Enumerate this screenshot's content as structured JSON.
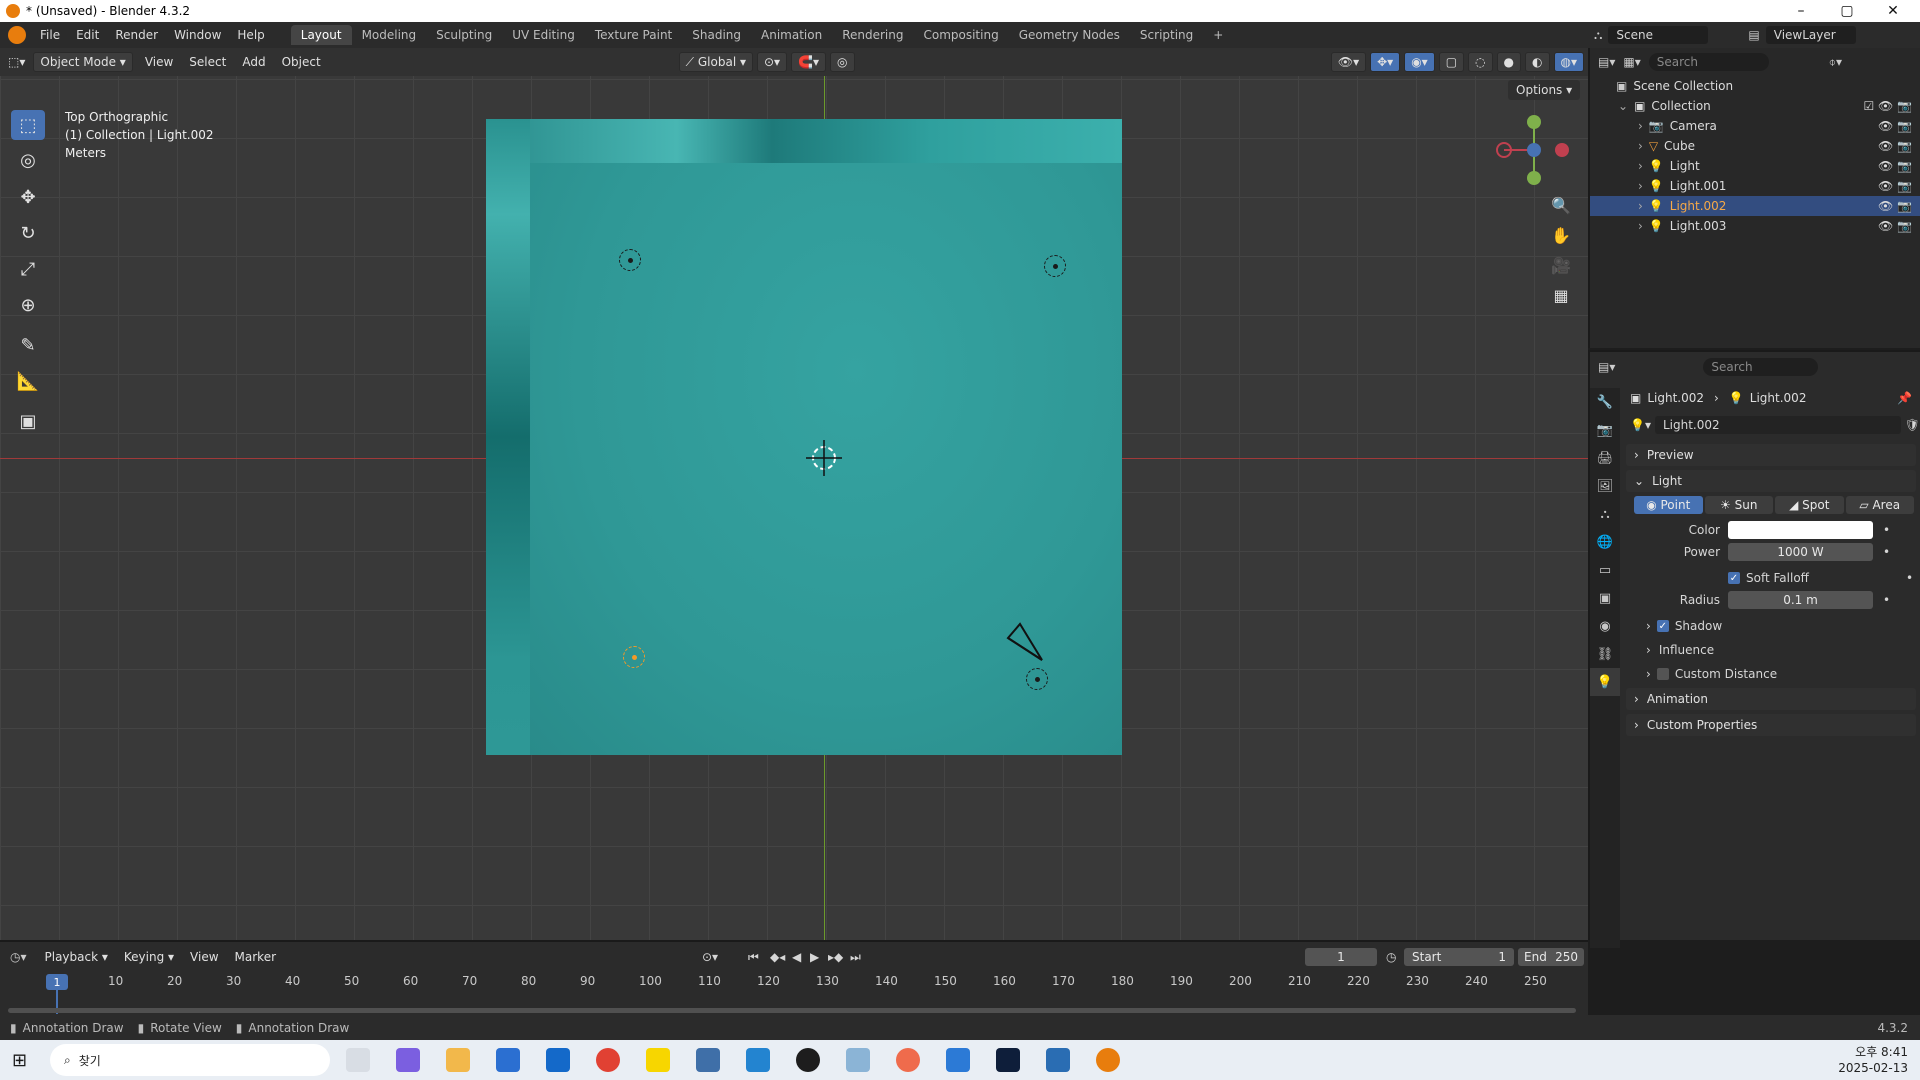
{
  "window": {
    "title": "* (Unsaved) - Blender 4.3.2",
    "minimize": "–",
    "maximize": "▢",
    "close": "✕"
  },
  "menu": {
    "items": [
      "File",
      "Edit",
      "Render",
      "Window",
      "Help"
    ]
  },
  "workspaces": {
    "tabs": [
      "Layout",
      "Modeling",
      "Sculpting",
      "UV Editing",
      "Texture Paint",
      "Shading",
      "Animation",
      "Rendering",
      "Compositing",
      "Geometry Nodes",
      "Scripting"
    ],
    "active": "Layout",
    "add": "+"
  },
  "scene": {
    "scene_name": "Scene",
    "view_layer": "ViewLayer"
  },
  "viewport": {
    "mode": "Object Mode",
    "menus": [
      "View",
      "Select",
      "Add",
      "Object"
    ],
    "transform_orientation": "Global",
    "options": "Options",
    "overlay_lines": [
      "Top Orthographic",
      "(1) Collection | Light.002",
      "Meters"
    ],
    "gizmo": {
      "x": "X",
      "y": "Y",
      "z": "Z"
    }
  },
  "outliner": {
    "search_placeholder": "Search",
    "root": "Scene Collection",
    "collection": "Collection",
    "items": [
      {
        "name": "Camera"
      },
      {
        "name": "Cube"
      },
      {
        "name": "Light"
      },
      {
        "name": "Light.001"
      },
      {
        "name": "Light.002",
        "selected": true
      },
      {
        "name": "Light.003"
      }
    ]
  },
  "properties": {
    "search_placeholder": "Search",
    "breadcrumb": [
      "Light.002",
      "Light.002"
    ],
    "datablock": "Light.002",
    "panels": {
      "preview": "Preview",
      "light": "Light",
      "animation": "Animation",
      "custom_properties": "Custom Properties"
    },
    "light_types": [
      "Point",
      "Sun",
      "Spot",
      "Area"
    ],
    "active_type": "Point",
    "color_label": "Color",
    "color_value": "#ffffff",
    "power_label": "Power",
    "power_value": "1000 W",
    "soft_falloff": "Soft Falloff",
    "radius_label": "Radius",
    "radius_value": "0.1 m",
    "shadow": "Shadow",
    "influence": "Influence",
    "custom_distance": "Custom Distance"
  },
  "timeline": {
    "menus": [
      "Playback",
      "Keying",
      "View",
      "Marker"
    ],
    "current_frame": "1",
    "start_label": "Start",
    "start_value": "1",
    "end_label": "End",
    "end_value": "250",
    "ticks": [
      "10",
      "20",
      "30",
      "40",
      "50",
      "60",
      "70",
      "80",
      "90",
      "100",
      "110",
      "120",
      "130",
      "140",
      "150",
      "160",
      "170",
      "180",
      "190",
      "200",
      "210",
      "220",
      "230",
      "240",
      "250"
    ],
    "playhead": "1"
  },
  "statusbar": {
    "items": [
      "Annotation Draw",
      "Rotate View",
      "Annotation Draw"
    ],
    "version": "4.3.2"
  },
  "taskbar": {
    "search": "찾기",
    "time": "오후 8:41",
    "date": "2025-02-13"
  },
  "colors": {
    "accent": "#4772b3",
    "selection": "#f39a28",
    "cube": "#2e9a98"
  }
}
